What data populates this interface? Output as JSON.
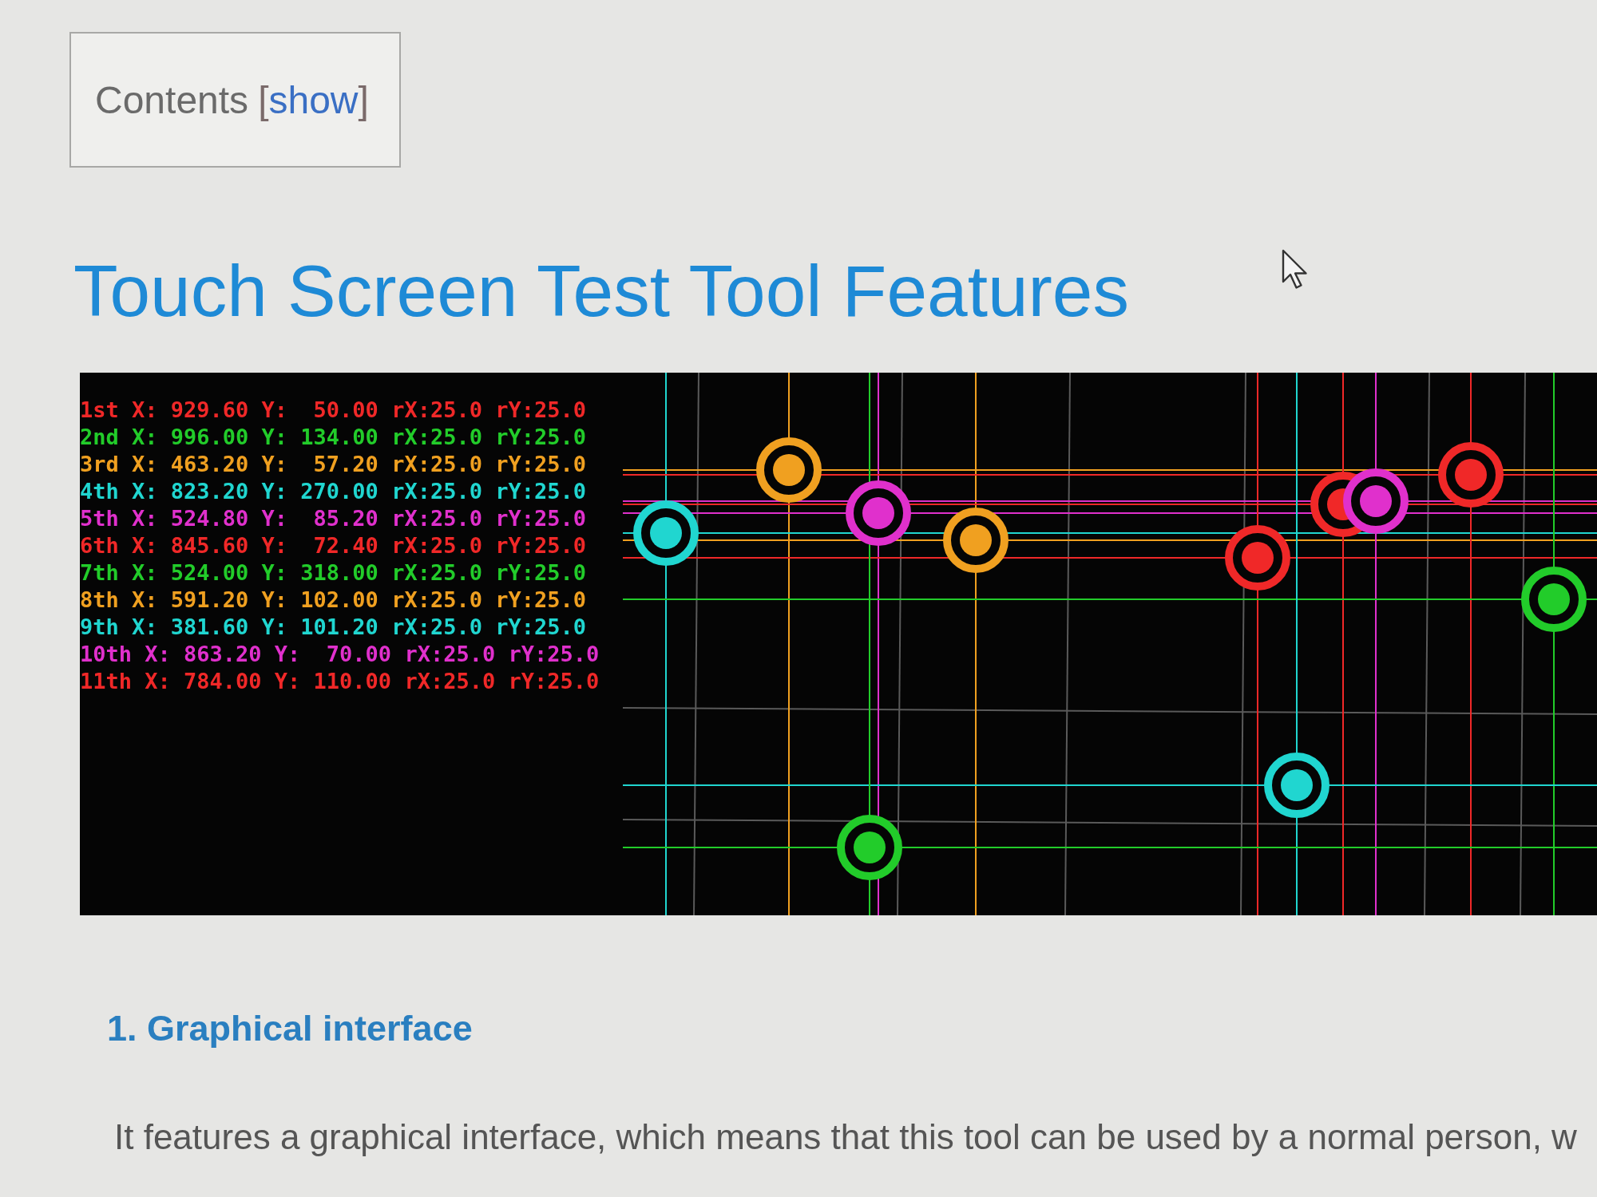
{
  "contents": {
    "title": "Contents",
    "toggle": {
      "open": "[",
      "label": "show",
      "close": "]"
    }
  },
  "heading": "Touch Screen Test Tool Features",
  "screenshot": {
    "readings": [
      {
        "text": "1st X: 929.60 Y:  50.00 rX:25.0 rY:25.0",
        "color": "#f02828"
      },
      {
        "text": "2nd X: 996.00 Y: 134.00 rX:25.0 rY:25.0",
        "color": "#22cc2a"
      },
      {
        "text": "3rd X: 463.20 Y:  57.20 rX:25.0 rY:25.0",
        "color": "#f0a020"
      },
      {
        "text": "4th X: 823.20 Y: 270.00 rX:25.0 rY:25.0",
        "color": "#20d6d0"
      },
      {
        "text": "5th X: 524.80 Y:  85.20 rX:25.0 rY:25.0",
        "color": "#e030cc"
      },
      {
        "text": "6th X: 845.60 Y:  72.40 rX:25.0 rY:25.0",
        "color": "#f02828"
      },
      {
        "text": "7th X: 524.00 Y: 318.00 rX:25.0 rY:25.0",
        "color": "#22cc2a"
      },
      {
        "text": "8th X: 591.20 Y: 102.00 rX:25.0 rY:25.0",
        "color": "#f0a020"
      },
      {
        "text": "9th X: 381.60 Y: 101.20 rX:25.0 rY:25.0",
        "color": "#20d6d0"
      },
      {
        "text": "10th X: 863.20 Y:  70.00 rX:25.0 rY:25.0",
        "color": "#e030cc"
      },
      {
        "text": "11th X: 784.00 Y: 110.00 rX:25.0 rY:25.0",
        "color": "#f02828"
      }
    ]
  },
  "section_heading": "1. Graphical interface",
  "paragraph": "It features a graphical interface, which means that this tool can be used by a normal person, w"
}
